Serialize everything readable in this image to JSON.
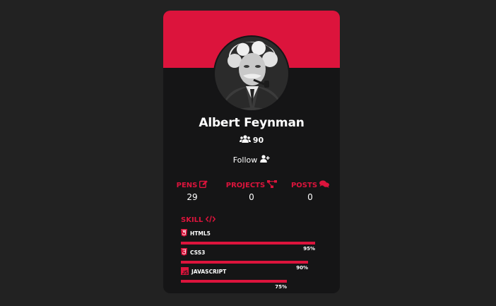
{
  "profile": {
    "name": "Albert Feynman",
    "followers": "90",
    "follow_label": "Follow"
  },
  "stats": [
    {
      "label": "PENS",
      "value": "29",
      "icon": "edit-icon"
    },
    {
      "label": "PROJECTS",
      "value": "0",
      "icon": "project-diagram-icon"
    },
    {
      "label": "POSTS",
      "value": "0",
      "icon": "comments-icon"
    }
  ],
  "skills": {
    "title": "SKILL",
    "items": [
      {
        "name": "HTML5",
        "percent": "95%",
        "level": 95,
        "icon": "html5-icon"
      },
      {
        "name": "CSS3",
        "percent": "90%",
        "level": 90,
        "icon": "css3-icon"
      },
      {
        "name": "JAVASCRIPT",
        "percent": "75%",
        "level": 75,
        "icon": "js-icon"
      }
    ]
  },
  "colors": {
    "accent": "#dc143c",
    "card": "#151516",
    "page": "#222222",
    "text": "#ffffff"
  }
}
